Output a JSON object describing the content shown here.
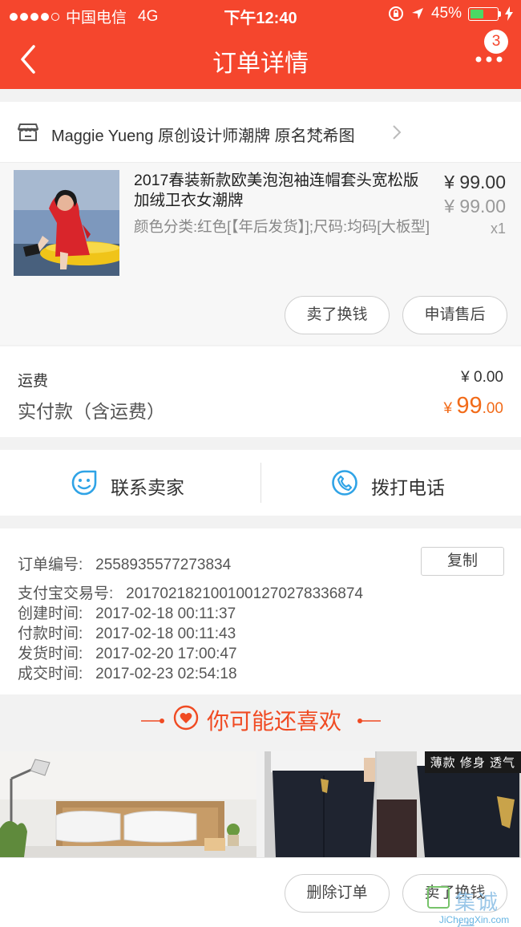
{
  "status_bar": {
    "carrier": "中国电信",
    "network": "4G",
    "time": "下午12:40",
    "battery_percent": "45%",
    "battery_level": 0.45
  },
  "nav": {
    "title": "订单详情",
    "badge_count": "3"
  },
  "shop": {
    "name": "Maggie Yueng 原创设计师潮牌 原名梵希图"
  },
  "product": {
    "title": "2017春装新款欧美泡泡袖连帽套头宽松版加绒卫衣女潮牌",
    "sku": "颜色分类:红色[【年后发货】];尺码:均码[大板型]",
    "price": "¥ 99.00",
    "original_price": "¥ 99.00",
    "quantity": "x1",
    "actions": {
      "sell": "卖了换钱",
      "after_sale": "申请售后"
    }
  },
  "fees": {
    "shipping_label": "运费",
    "shipping_value": "¥ 0.00",
    "paid_label": "实付款（含运费）",
    "paid_symbol": "¥ ",
    "paid_int": "99",
    "paid_dec": ".00"
  },
  "contact": {
    "seller": "联系卖家",
    "phone": "拨打电话"
  },
  "order_info": {
    "order_no_label": "订单编号:",
    "order_no": "2558935577273834",
    "copy": "复制",
    "alipay_label": "支付宝交易号:",
    "alipay_no": "2017021821001001270278336874",
    "created_label": "创建时间:",
    "created": "2017-02-18 00:11:37",
    "paid_label": "付款时间:",
    "paid": "2017-02-18 00:11:43",
    "shipped_label": "发货时间:",
    "shipped": "2017-02-20 17:00:47",
    "completed_label": "成交时间:",
    "completed": "2017-02-23 02:54:18"
  },
  "recommend": {
    "title": "你可能还喜欢",
    "item2_tag": "薄款 修身 透气"
  },
  "bottom": {
    "delete": "删除订单",
    "sell": "卖了换钱"
  },
  "watermark": {
    "cn": "集诚信",
    "en": "JiChengXin.com"
  },
  "colors": {
    "brand": "#f5462d",
    "price_accent": "#f26b19",
    "icon_blue": "#2fa3e6"
  }
}
